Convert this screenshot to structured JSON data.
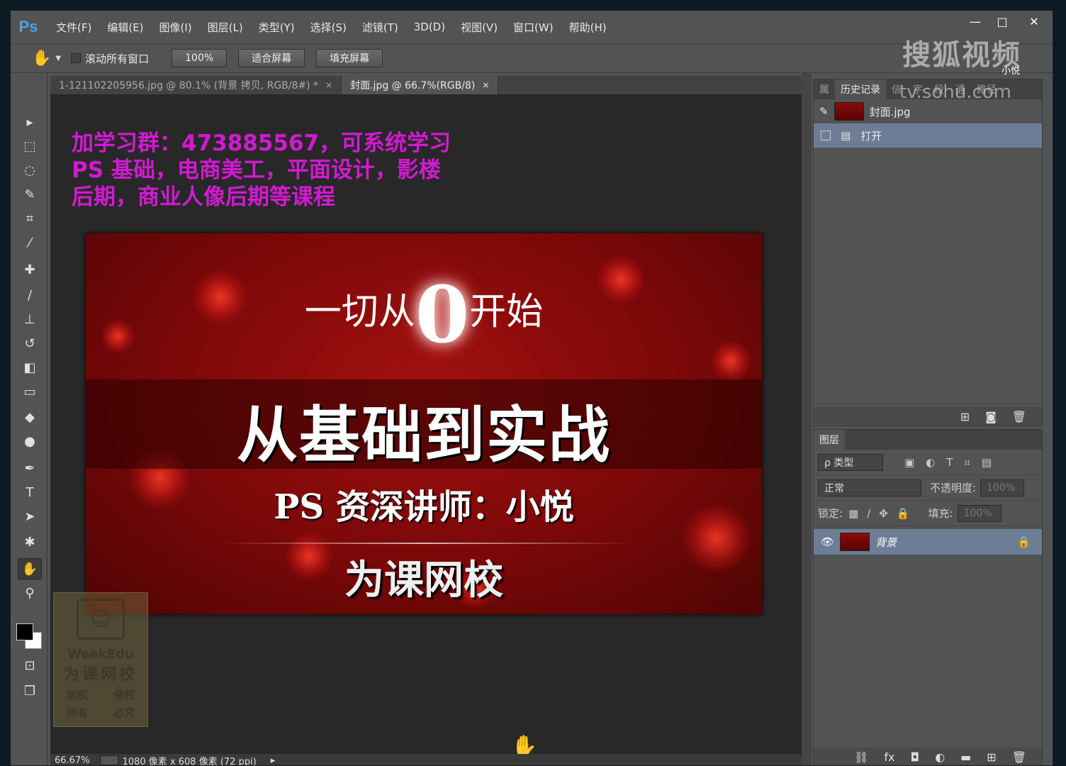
{
  "app": {
    "logo": "Ps"
  },
  "menu": [
    "文件(F)",
    "编辑(E)",
    "图像(I)",
    "图层(L)",
    "类型(Y)",
    "选择(S)",
    "滤镜(T)",
    "3D(D)",
    "视图(V)",
    "窗口(W)",
    "帮助(H)"
  ],
  "window_controls": {
    "minimize": "—",
    "maximize": "□",
    "close": "✕"
  },
  "options": {
    "tool_icon": "hand-icon",
    "scroll_all_label": "滚动所有窗口",
    "btn_100": "100%",
    "btn_fit": "适合屏幕",
    "btn_fill": "填充屏幕"
  },
  "tabs": [
    {
      "label": "1-121102205956.jpg @ 80.1% (背景 拷贝, RGB/8#) *",
      "close": "×"
    },
    {
      "label": "封面.jpg @ 66.7%(RGB/8)",
      "close": "×"
    }
  ],
  "overlay_text": [
    "加学习群：473885567，可系统学习",
    "PS 基础，电商美工，平面设计，影楼",
    "后期，商业人像后期等课程"
  ],
  "artwork": {
    "line1_a": "一切从",
    "line1_zero": "0",
    "line1_b": "开始",
    "title": "从基础到实战",
    "subtitle": "PS 资深讲师：小悦",
    "brand": "为课网校"
  },
  "watermark": {
    "brand": "WeekEdu",
    "cn": "为课网校",
    "left_top": "版权",
    "left_bottom": "所有",
    "right_top": "侵权",
    "right_bottom": "必究"
  },
  "status": {
    "zoom": "66.67%",
    "dims": "1080 像素 x 608 像素 (72 ppi)"
  },
  "history_panel": {
    "tabs": [
      "属",
      "历史记录",
      "信",
      "字",
      "段",
      "通",
      "路径"
    ],
    "snapshot": "封面.jpg",
    "items": [
      "打开"
    ]
  },
  "layers_panel": {
    "tab": "图层",
    "filter_label": "ρ 类型",
    "blend_mode": "正常",
    "opacity_label": "不透明度:",
    "opacity_value": "100%",
    "lock_label": "锁定:",
    "fill_label": "填充:",
    "fill_value": "100%",
    "layer_name": "背景"
  },
  "sohu": {
    "logo": "搜狐视频",
    "url": "tv.sohu.com",
    "tag": "小悦"
  },
  "colors": {
    "ui_bg": "#535353",
    "canvas_bg": "#282828",
    "overlay_text": "#d21ad2",
    "selection": "#6d7d96",
    "art_red": "#a31010"
  }
}
